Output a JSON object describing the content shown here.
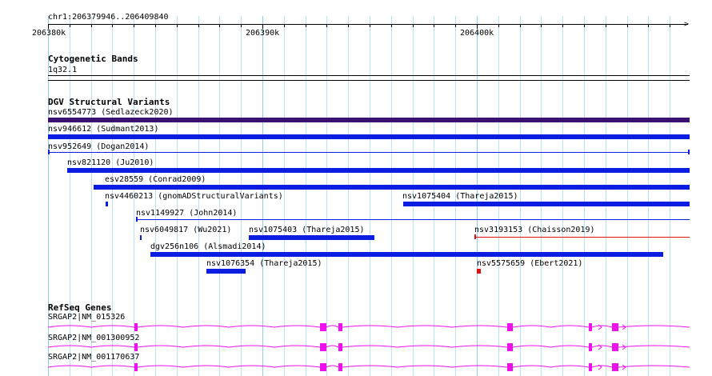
{
  "ruler": {
    "location": "chr1:206379946..206409840",
    "ticks": [
      "206380k",
      "206390k",
      "206400k"
    ]
  },
  "cytoband": {
    "track_name": "Cytogenetic Bands",
    "band": "1q32.1"
  },
  "dgv": {
    "track_name": "DGV Structural Variants",
    "features": [
      {
        "label": "nsv6554773 (Sedlazeck2020)",
        "color": "#3b1272"
      },
      {
        "label": "nsv946612 (Sudmant2013)",
        "color": "#0b1de0"
      },
      {
        "label": "nsv952649 (Dogan2014)",
        "color": "#0b1de0"
      },
      {
        "label": "nsv821120 (Ju2010)",
        "color": "#0b1de0"
      },
      {
        "label": "esv28559 (Conrad2009)",
        "color": "#0b1de0"
      },
      {
        "label": "nsv4460213 (gnomADStructuralVariants)",
        "color": "#0b1de0"
      },
      {
        "label": "nsv1075404 (Thareja2015)",
        "color": "#0b1de0"
      },
      {
        "label": "nsv1149927 (John2014)",
        "color": "#0b1de0"
      },
      {
        "label": "nsv6049817 (Wu2021)",
        "color": "#0b1de0"
      },
      {
        "label": "nsv1075403 (Thareja2015)",
        "color": "#0b1de0"
      },
      {
        "label": "nsv3193153 (Chaisson2019)",
        "color": "#e01010"
      },
      {
        "label": "dgv256n106 (Alsmadi2014)",
        "color": "#0b1de0"
      },
      {
        "label": "nsv1076354 (Thareja2015)",
        "color": "#0b1de0"
      },
      {
        "label": "nsv5575659 (Ebert2021)",
        "color": "#e01010"
      }
    ]
  },
  "refseq": {
    "track_name": "RefSeq Genes",
    "color": "#ee11ee",
    "transcripts": [
      {
        "label": "SRGAP2|NM_015326"
      },
      {
        "label": "SRGAP2|NM_001300952"
      },
      {
        "label": "SRGAP2|NM_001170637"
      }
    ]
  }
}
